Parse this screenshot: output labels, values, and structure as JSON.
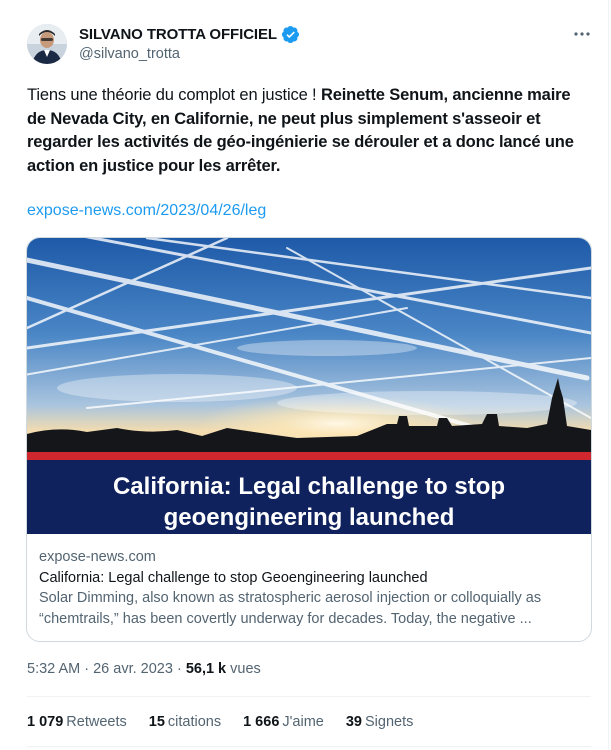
{
  "author": {
    "name": "SILVANO TROTTA OFFICIEL",
    "handle": "@silvano_trotta"
  },
  "more_icon": "more-dots-icon",
  "verified_icon": "verified-badge-icon",
  "tweet": {
    "text_plain": "Tiens une théorie du complot en justice ! ",
    "text_bold": "Reinette Senum, ancienne maire de Nevada City, en Californie, ne peut plus simplement s'asseoir et regarder les activités de géo-ingénierie se dérouler et a donc lancé une action en justice pour les arrêter.",
    "link": "expose-news.com/2023/04/26/leg"
  },
  "card": {
    "image_banner_line1": "California: Legal challenge to stop",
    "image_banner_line2": "geoengineering launched",
    "domain": "expose-news.com",
    "title": "California: Legal challenge to stop Geoengineering launched",
    "description": "Solar Dimming, also known as stratospheric aerosol injection or colloquially as “chemtrails,” has been covertly underway for decades. Today, the negative ..."
  },
  "meta": {
    "time": "5:32 AM",
    "sep1": " · ",
    "date": "26 avr. 2023",
    "sep2": " · ",
    "views_count": "56,1 k",
    "views_label": " vues"
  },
  "stats": {
    "retweets_count": "1 079",
    "retweets_label": "Retweets",
    "quotes_count": "15",
    "quotes_label": "citations",
    "likes_count": "1 666",
    "likes_label": "J'aime",
    "bookmarks_count": "39",
    "bookmarks_label": "Signets"
  },
  "colors": {
    "link": "#1d9bf0",
    "verified": "#1d9bf0",
    "banner_bg": "#10225e",
    "banner_red": "#d0262d"
  }
}
